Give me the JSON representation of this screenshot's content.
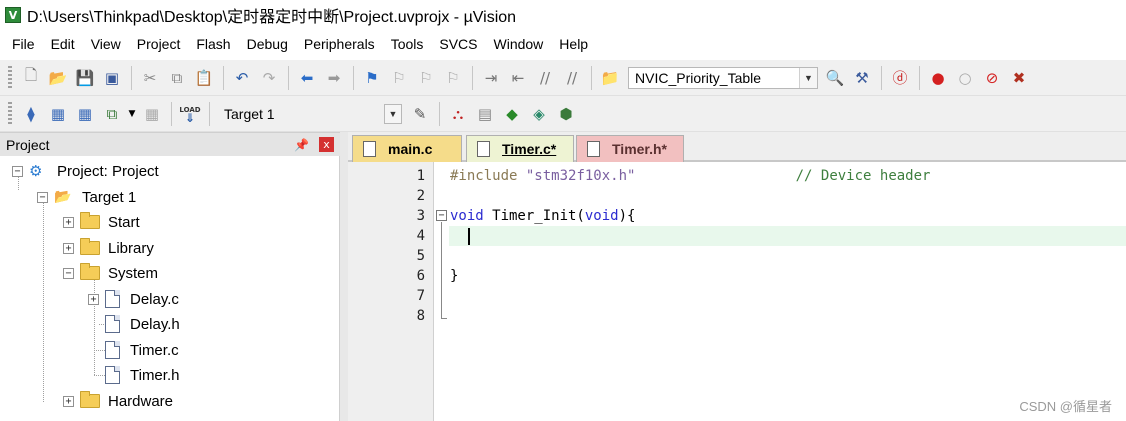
{
  "window": {
    "title": "D:\\Users\\Thinkpad\\Desktop\\定时器定时中断\\Project.uvprojx - µVision",
    "icon_name": "uvision-app-icon",
    "icon_letter": "V"
  },
  "menu": [
    "File",
    "Edit",
    "View",
    "Project",
    "Flash",
    "Debug",
    "Peripherals",
    "Tools",
    "SVCS",
    "Window",
    "Help"
  ],
  "toolbar": {
    "find_combo_value": "NVIC_Priority_Table",
    "target_combo_value": "Target 1",
    "load_label": "LOAD"
  },
  "project_panel": {
    "title": "Project",
    "pin": "📌",
    "close": "x",
    "tree": {
      "root": "Project: Project",
      "target": "Target 1",
      "groups": [
        "Start",
        "Library",
        "System",
        "Hardware"
      ],
      "system_files": [
        "Delay.c",
        "Delay.h",
        "Timer.c",
        "Timer.h"
      ]
    }
  },
  "tabs": [
    {
      "label": "main.c"
    },
    {
      "label": "Timer.c*"
    },
    {
      "label": "Timer.h*"
    }
  ],
  "editor": {
    "line_numbers": [
      "1",
      "2",
      "3",
      "4",
      "5",
      "6",
      "7",
      "8"
    ],
    "line1": {
      "pp": "#include",
      "str": "\"stm32f10x.h\"",
      "cmt": "// Device header"
    },
    "line3": {
      "kw": "void",
      "fn": " Timer_Init(",
      "kw2": "void",
      "end": "){"
    },
    "line6": "}"
  },
  "watermark": "CSDN @循星者"
}
